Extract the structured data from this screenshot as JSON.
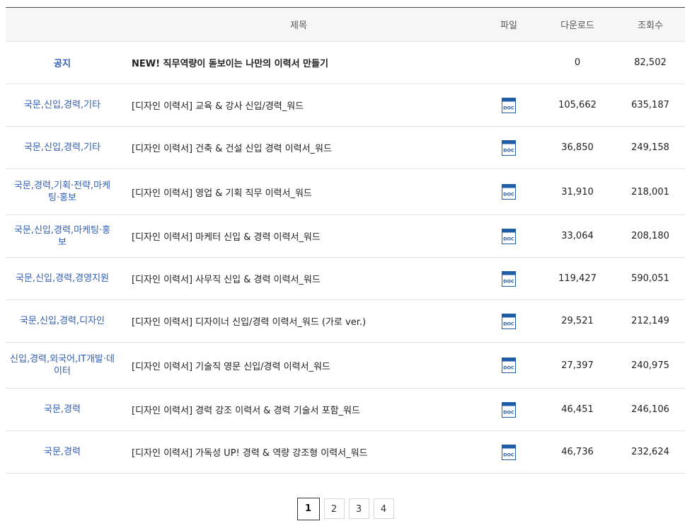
{
  "table": {
    "headers": {
      "category": "",
      "title": "제목",
      "file": "파일",
      "downloads": "다운로드",
      "views": "조회수"
    },
    "notice": {
      "category": "공지",
      "title": "NEW! 직무역량이 돋보이는 나만의 이력서 만들기",
      "downloads": "0",
      "views": "82,502"
    },
    "rows": [
      {
        "category": "국문,신입,경력,기타",
        "title": "[디자인 이력서] 교육 & 강사 신입/경력_워드",
        "file_icon": "doc-file-icon",
        "downloads": "105,662",
        "views": "635,187"
      },
      {
        "category": "국문,신입,경력,기타",
        "title": "[디자인 이력서] 건축 & 건설 신입 경력 이력서_워드",
        "file_icon": "doc-file-icon",
        "downloads": "36,850",
        "views": "249,158"
      },
      {
        "category": "국문,경력,기획·전략,마케팅·홍보",
        "title": "[디자인 이력서] 영업 & 기획 직무 이력서_워드",
        "file_icon": "doc-file-icon",
        "downloads": "31,910",
        "views": "218,001"
      },
      {
        "category": "국문,신입,경력,마케팅·홍보",
        "title": "[디자인 이력서] 마케터 신입 & 경력 이력서_워드",
        "file_icon": "doc-file-icon",
        "downloads": "33,064",
        "views": "208,180"
      },
      {
        "category": "국문,신입,경력,경영지원",
        "title": "[디자인 이력서] 사무직 신입 & 경력 이력서_워드",
        "file_icon": "doc-file-icon",
        "downloads": "119,427",
        "views": "590,051"
      },
      {
        "category": "국문,신입,경력,디자인",
        "title": "[디자인 이력서] 디자이너 신입/경력 이력서_워드 (가로 ver.)",
        "file_icon": "doc-file-icon",
        "downloads": "29,521",
        "views": "212,149"
      },
      {
        "category": "신입,경력,외국어,IT개발·데이터",
        "title": "[디자인 이력서] 기술직 영문 신입/경력 이력서_워드",
        "file_icon": "doc-file-icon",
        "downloads": "27,397",
        "views": "240,975"
      },
      {
        "category": "국문,경력",
        "title": "[디자인 이력서] 경력 강조 이력서 & 경력 기술서 포함_워드",
        "file_icon": "doc-file-icon",
        "downloads": "46,451",
        "views": "246,106"
      },
      {
        "category": "국문,경력",
        "title": "[디자인 이력서] 가독성 UP! 경력 & 역량 강조형 이력서_워드",
        "file_icon": "doc-file-icon",
        "downloads": "46,736",
        "views": "232,624"
      }
    ]
  },
  "pagination": {
    "pages": [
      "1",
      "2",
      "3",
      "4"
    ],
    "current": "1"
  },
  "colors": {
    "category_link": "#2c5fbd",
    "doc_icon_blue": "#1f5da8",
    "header_bg": "#f6f6f6"
  }
}
